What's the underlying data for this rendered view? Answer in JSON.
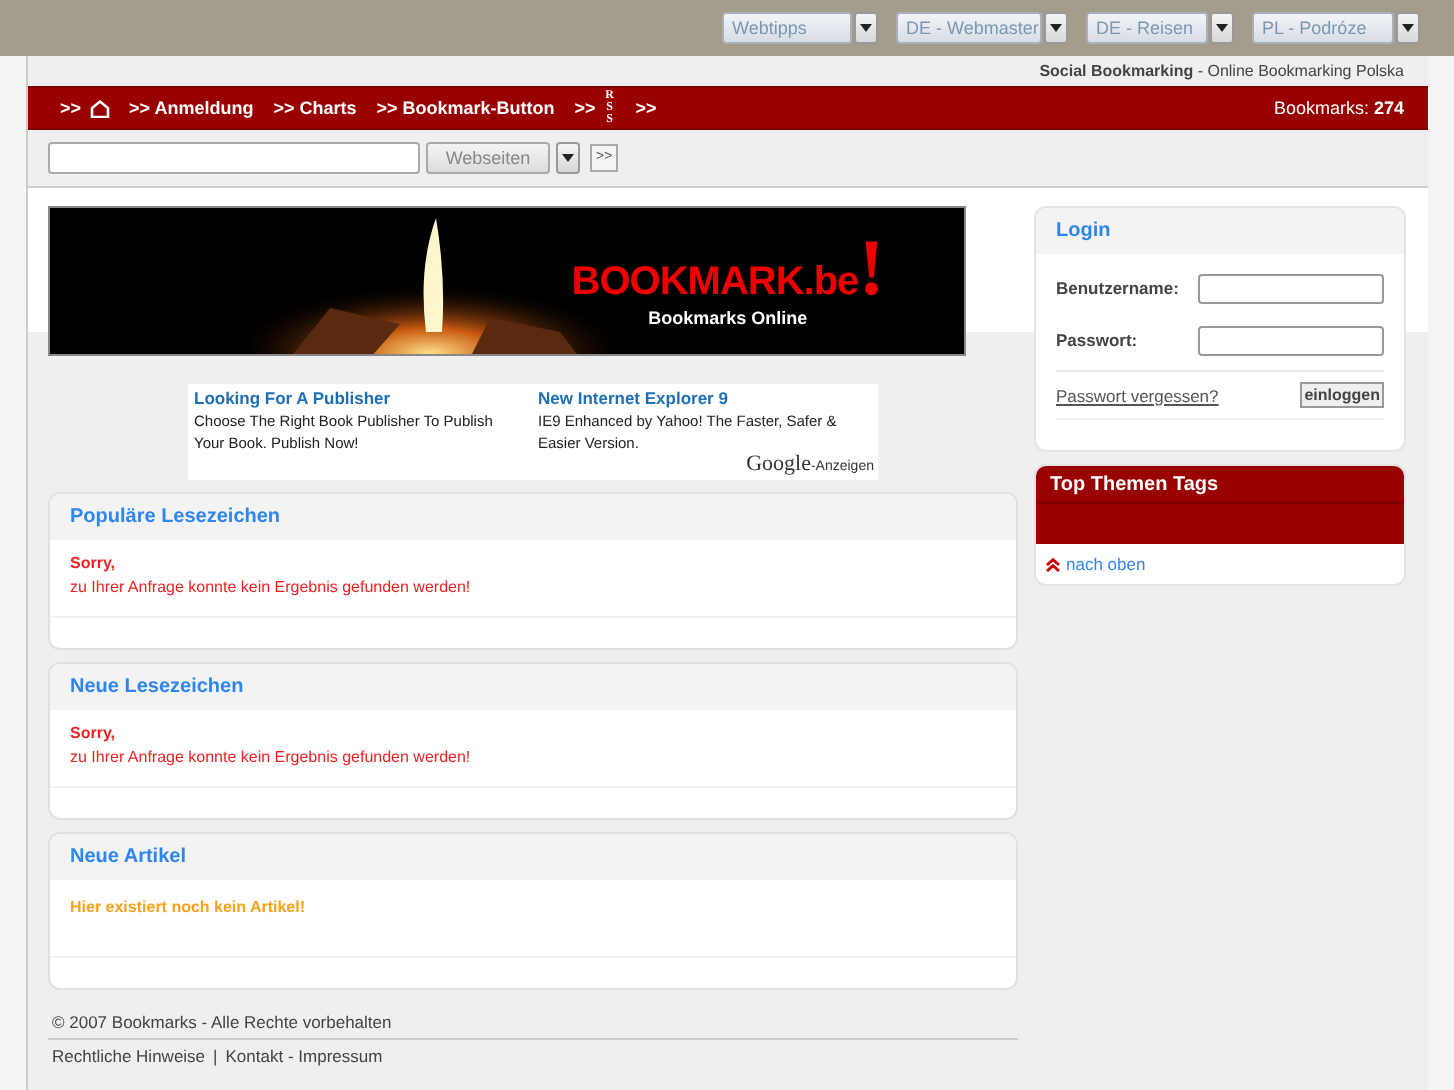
{
  "top_bar": {
    "dropdowns": [
      {
        "value": "Webtipps"
      },
      {
        "value": "DE - Webmaster"
      },
      {
        "value": "DE - Reisen"
      },
      {
        "value": "PL - Podróze"
      }
    ]
  },
  "tagline": {
    "bold": "Social Bookmarking",
    "rest": " - Online Bookmarking Polska"
  },
  "nav": {
    "items": [
      {
        "kind": "home",
        "prefix": ">>"
      },
      {
        "kind": "link",
        "prefix": ">>",
        "label": "Anmeldung"
      },
      {
        "kind": "link",
        "prefix": ">>",
        "label": "Charts"
      },
      {
        "kind": "link",
        "prefix": ">>",
        "label": "Bookmark-Button"
      },
      {
        "kind": "rss",
        "prefix": ">>",
        "label": "RSS"
      },
      {
        "kind": "link",
        "prefix": ">>"
      }
    ],
    "count_label": "Bookmarks: ",
    "count": "274"
  },
  "search": {
    "scope": "Webseiten",
    "submit": ">>"
  },
  "banner": {
    "title": "BOOKMARK.be",
    "mark": "!",
    "subtitle": "Bookmarks Online"
  },
  "ads": {
    "items": [
      {
        "title": "Looking For A Publisher",
        "text": "Choose The Right Book Publisher To Publish Your Book. Publish Now!"
      },
      {
        "title": "New Internet Explorer 9",
        "text": "IE9 Enhanced by Yahoo! The Faster, Safer & Easier Version."
      }
    ],
    "brand": "Google",
    "suffix": "-Anzeigen"
  },
  "panels": [
    {
      "title": "Populäre Lesezeichen",
      "kind": "error",
      "heading": "Sorry,",
      "message": "zu Ihrer Anfrage konnte kein Ergebnis gefunden werden!"
    },
    {
      "title": "Neue Lesezeichen",
      "kind": "error",
      "heading": "Sorry,",
      "message": "zu Ihrer Anfrage konnte kein Ergebnis gefunden werden!"
    },
    {
      "title": "Neue Artikel",
      "kind": "notice",
      "message": "Hier existiert noch kein Artikel!"
    }
  ],
  "login": {
    "title": "Login",
    "username_label": "Benutzername:",
    "password_label": "Passwort:",
    "forgot_link": "Passwort vergessen?",
    "submit": "einloggen"
  },
  "tags": {
    "title": "Top Themen Tags",
    "back_link": "nach oben"
  },
  "footer": {
    "copyright": "© 2007 Bookmarks - Alle Rechte vorbehalten",
    "links": [
      {
        "label": "Rechtliche Hinweise"
      },
      {
        "separator": "|",
        "label": "Kontakt - Impressum"
      }
    ]
  }
}
